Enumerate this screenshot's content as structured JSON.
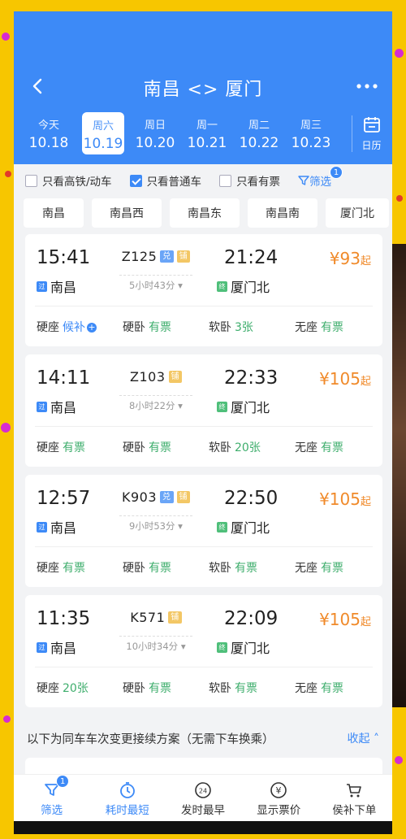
{
  "header": {
    "title": "南昌 <> 厦门",
    "dates": [
      {
        "weekday": "今天",
        "date": "10.18"
      },
      {
        "weekday": "周六",
        "date": "10.19"
      },
      {
        "weekday": "周日",
        "date": "10.20"
      },
      {
        "weekday": "周一",
        "date": "10.21"
      },
      {
        "weekday": "周二",
        "date": "10.22"
      },
      {
        "weekday": "周三",
        "date": "10.23"
      }
    ],
    "calendar_label": "日历"
  },
  "filters": {
    "only_high_speed": "只看高铁/动车",
    "only_normal": "只看普通车",
    "only_available": "只看有票",
    "filter_label": "筛选",
    "filter_count": "1"
  },
  "stations": [
    "南昌",
    "南昌西",
    "南昌东",
    "南昌南",
    "厦门北"
  ],
  "trains": [
    {
      "depart_time": "15:41",
      "depart_station": "南昌",
      "depart_tag": "过",
      "train_no": "Z125",
      "badge1": "兑",
      "badge2": "铺",
      "duration": "5小时43分",
      "arrive_time": "21:24",
      "arrive_station": "厦门北",
      "arrive_tag": "终",
      "price": "¥93",
      "price_suffix": "起",
      "seats": [
        {
          "name": "硬座",
          "status": "候补"
        },
        {
          "name": "硬卧",
          "status": "有票"
        },
        {
          "name": "软卧",
          "status": "3张"
        },
        {
          "name": "无座",
          "status": "有票"
        }
      ]
    },
    {
      "depart_time": "14:11",
      "depart_station": "南昌",
      "depart_tag": "过",
      "train_no": "Z103",
      "badge2": "铺",
      "duration": "8小时22分",
      "arrive_time": "22:33",
      "arrive_station": "厦门北",
      "arrive_tag": "终",
      "price": "¥105",
      "price_suffix": "起",
      "seats": [
        {
          "name": "硬座",
          "status": "有票"
        },
        {
          "name": "硬卧",
          "status": "有票"
        },
        {
          "name": "软卧",
          "status": "20张"
        },
        {
          "name": "无座",
          "status": "有票"
        }
      ]
    },
    {
      "depart_time": "12:57",
      "depart_station": "南昌",
      "depart_tag": "过",
      "train_no": "K903",
      "badge1": "兑",
      "badge2": "铺",
      "duration": "9小时53分",
      "arrive_time": "22:50",
      "arrive_station": "厦门北",
      "arrive_tag": "终",
      "price": "¥105",
      "price_suffix": "起",
      "seats": [
        {
          "name": "硬座",
          "status": "有票"
        },
        {
          "name": "硬卧",
          "status": "有票"
        },
        {
          "name": "软卧",
          "status": "有票"
        },
        {
          "name": "无座",
          "status": "有票"
        }
      ]
    },
    {
      "depart_time": "11:35",
      "depart_station": "南昌",
      "depart_tag": "过",
      "train_no": "K571",
      "badge2": "铺",
      "duration": "10小时34分",
      "arrive_time": "22:09",
      "arrive_station": "厦门北",
      "arrive_tag": "终",
      "price": "¥105",
      "price_suffix": "起",
      "seats": [
        {
          "name": "硬座",
          "status": "20张"
        },
        {
          "name": "硬卧",
          "status": "有票"
        },
        {
          "name": "软卧",
          "status": "有票"
        },
        {
          "name": "无座",
          "status": "有票"
        }
      ]
    }
  ],
  "note": {
    "text": "以下为同车车次变更接续方案（无需下车换乘）",
    "collapse": "收起"
  },
  "tabbar": [
    {
      "label": "筛选",
      "icon": "filter-icon",
      "badge": "1"
    },
    {
      "label": "耗时最短",
      "icon": "timer-icon"
    },
    {
      "label": "发时最早",
      "icon": "clock-24-icon",
      "glyph": "24"
    },
    {
      "label": "显示票价",
      "icon": "yen-icon",
      "glyph": "¥"
    },
    {
      "label": "侯补下单",
      "icon": "cart-icon"
    }
  ],
  "colors": {
    "primary": "#3d8af7",
    "price": "#f08a2a",
    "available": "#3fae6d"
  }
}
